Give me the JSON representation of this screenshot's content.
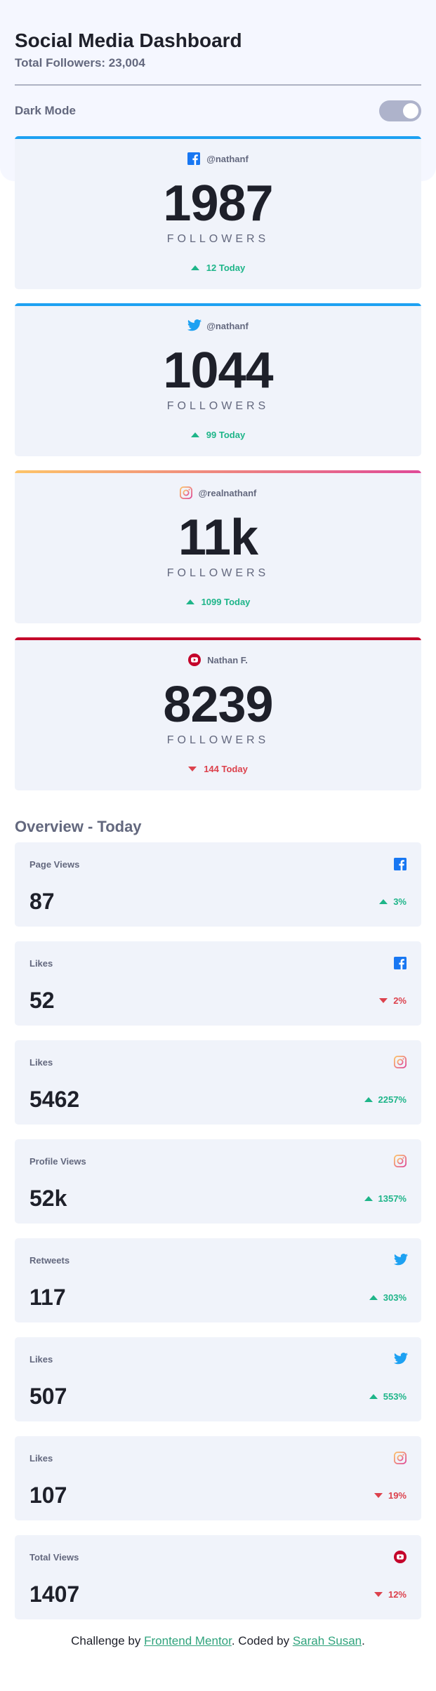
{
  "header": {
    "title": "Social Media Dashboard",
    "total": "Total Followers: 23,004",
    "dark_mode_label": "Dark Mode"
  },
  "colors": {
    "facebook": "#1877f2",
    "twitter": "#1da1f2",
    "instagram_start": "#fdc468",
    "instagram_end": "#df4996",
    "youtube": "#c4032a",
    "up": "#1eb589",
    "down": "#dc414c"
  },
  "followers": [
    {
      "network": "facebook",
      "icon": "facebook-icon",
      "handle": "@nathanf",
      "count": "1987",
      "label": "FOLLOWERS",
      "today": "12 Today",
      "trend": "up"
    },
    {
      "network": "twitter",
      "icon": "twitter-icon",
      "handle": "@nathanf",
      "count": "1044",
      "label": "FOLLOWERS",
      "today": "99 Today",
      "trend": "up"
    },
    {
      "network": "instagram",
      "icon": "instagram-icon",
      "handle": "@realnathanf",
      "count": "11k",
      "label": "FOLLOWERS",
      "today": "1099 Today",
      "trend": "up"
    },
    {
      "network": "youtube",
      "icon": "youtube-icon",
      "handle": "Nathan F.",
      "count": "8239",
      "label": "FOLLOWERS",
      "today": "144 Today",
      "trend": "down"
    }
  ],
  "overview": {
    "title": "Overview - Today",
    "items": [
      {
        "label": "Page Views",
        "network": "facebook",
        "icon": "facebook-icon",
        "value": "87",
        "change": "3%",
        "trend": "up"
      },
      {
        "label": "Likes",
        "network": "facebook",
        "icon": "facebook-icon",
        "value": "52",
        "change": "2%",
        "trend": "down"
      },
      {
        "label": "Likes",
        "network": "instagram",
        "icon": "instagram-icon",
        "value": "5462",
        "change": "2257%",
        "trend": "up"
      },
      {
        "label": "Profile Views",
        "network": "instagram",
        "icon": "instagram-icon",
        "value": "52k",
        "change": "1357%",
        "trend": "up"
      },
      {
        "label": "Retweets",
        "network": "twitter",
        "icon": "twitter-icon",
        "value": "117",
        "change": "303%",
        "trend": "up"
      },
      {
        "label": "Likes",
        "network": "twitter",
        "icon": "twitter-icon",
        "value": "507",
        "change": "553%",
        "trend": "up"
      },
      {
        "label": "Likes",
        "network": "instagram",
        "icon": "instagram-icon",
        "value": "107",
        "change": "19%",
        "trend": "down"
      },
      {
        "label": "Total Views",
        "network": "youtube",
        "icon": "youtube-icon",
        "value": "1407",
        "change": "12%",
        "trend": "down"
      }
    ]
  },
  "footer": {
    "prefix": "Challenge by ",
    "link1": "Frontend Mentor",
    "middle": ". Coded by ",
    "link2": "Sarah Susan",
    "suffix": "."
  }
}
